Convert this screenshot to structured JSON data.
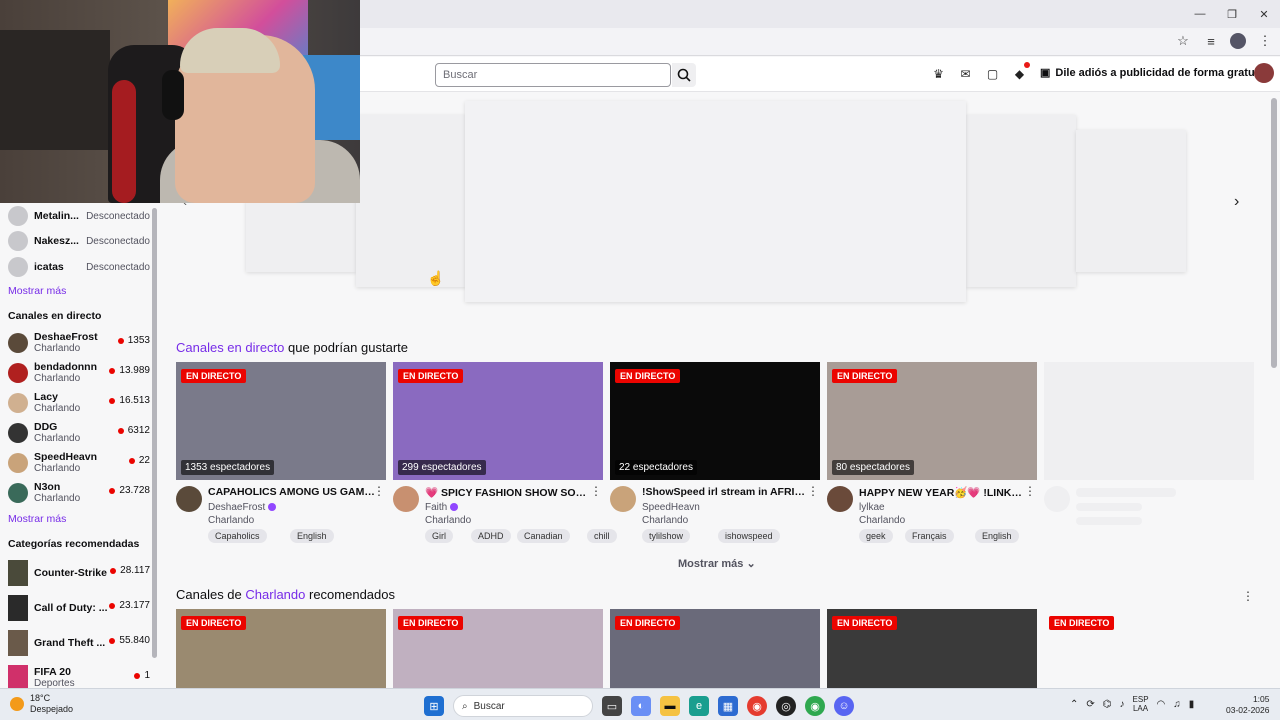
{
  "browser": {
    "win_controls": [
      "—",
      "❐",
      "✕"
    ],
    "addr_icons": [
      "star-icon",
      "media-icon",
      "profile-icon",
      "menu-icon"
    ]
  },
  "topnav": {
    "search_placeholder": "Buscar",
    "adfree_label": "Dile adiós a publicidad de forma gratuita"
  },
  "sidebar": {
    "followed_offline": [
      {
        "name": "Metalin...",
        "status": "Desconectado"
      },
      {
        "name": "Nakesz...",
        "status": "Desconectado"
      },
      {
        "name": "icatas",
        "status": "Desconectado"
      }
    ],
    "show_more_1": "Mostrar más",
    "live_heading": "Canales en directo",
    "live_channels": [
      {
        "name": "DeshaeFrost",
        "category": "Charlando",
        "viewers": "1353",
        "color": "#5a4a3a"
      },
      {
        "name": "bendadonnn",
        "category": "Charlando",
        "viewers": "13.989",
        "color": "#b0201f"
      },
      {
        "name": "Lacy",
        "category": "Charlando",
        "viewers": "16.513",
        "color": "#d0b090"
      },
      {
        "name": "DDG",
        "category": "Charlando",
        "viewers": "6312",
        "color": "#333"
      },
      {
        "name": "SpeedHeavn",
        "category": "Charlando",
        "viewers": "22",
        "color": "#c9a37a"
      },
      {
        "name": "N3on",
        "category": "Charlando",
        "viewers": "23.728",
        "color": "#3a6a5a"
      }
    ],
    "show_more_2": "Mostrar más",
    "cat_heading": "Categorías recomendadas",
    "categories": [
      {
        "name": "Counter-Strike",
        "viewers": "28.117",
        "color": "#4a4a3a"
      },
      {
        "name": "Call of Duty: ...",
        "viewers": "23.177",
        "color": "#2a2a2a"
      },
      {
        "name": "Grand Theft ...",
        "viewers": "55.840",
        "color": "#6a5a4a"
      },
      {
        "name": "FIFA 20",
        "sub": "Deportes",
        "viewers": "1",
        "color": "#d0306a"
      }
    ]
  },
  "section1": {
    "title_hl": "Canales en directo",
    "title_rest": " que podrían gustarte",
    "cards": [
      {
        "badge": "EN DIRECTO",
        "viewers": "1353 espectadores",
        "title": "CAPAHOLICS AMONG US GAME N...",
        "channel": "DeshaeFrost",
        "verified": true,
        "category": "Charlando",
        "tags": [
          "Capaholics",
          "English"
        ],
        "thumb": "#7a7a8a",
        "av": "#5a4a3a"
      },
      {
        "badge": "EN DIRECTO",
        "viewers": "299 espectadores",
        "title": "💗 SPICY FASHION SHOW SOON ...",
        "channel": "Faith",
        "verified": true,
        "category": "Charlando",
        "tags": [
          "Girl",
          "ADHD",
          "Canadian",
          "chill"
        ],
        "thumb": "#8a6ac0",
        "av": "#c89070"
      },
      {
        "badge": "EN DIRECTO",
        "viewers": "22 espectadores",
        "title": "!ShowSpeed irl stream in AFRICA (...",
        "channel": "SpeedHeavn",
        "verified": false,
        "category": "Charlando",
        "tags": [
          "tylilshow",
          "ishowspeed"
        ],
        "thumb": "#0a0a0a",
        "av": "#c9a37a"
      },
      {
        "badge": "EN DIRECTO",
        "viewers": "80 espectadores",
        "title": "HAPPY NEW YEAR🥳💗 !LINKTRE...",
        "channel": "lylkae",
        "verified": false,
        "category": "Charlando",
        "tags": [
          "geek",
          "Français",
          "English"
        ],
        "thumb": "#a89c96",
        "av": "#6a4a3a"
      }
    ],
    "show_more": "Mostrar más"
  },
  "section2": {
    "title_pre": "Canales de ",
    "title_hl": "Charlando",
    "title_rest": " recomendados",
    "cards": [
      {
        "badge": "EN DIRECTO",
        "thumb": "#9a8a70"
      },
      {
        "badge": "EN DIRECTO",
        "thumb": "#c0b0c0"
      },
      {
        "badge": "EN DIRECTO",
        "thumb": "#6a6a7a"
      },
      {
        "badge": "EN DIRECTO",
        "thumb": "#3a3a3a"
      },
      {
        "badge": "EN DIRECTO",
        "thumb": "transparent"
      }
    ]
  },
  "taskbar": {
    "temp": "18°C",
    "weather": "Despejado",
    "search": "Buscar",
    "lang1": "ESP",
    "lang2": "LAA",
    "time": "1:05",
    "date": "03-02-2026"
  }
}
